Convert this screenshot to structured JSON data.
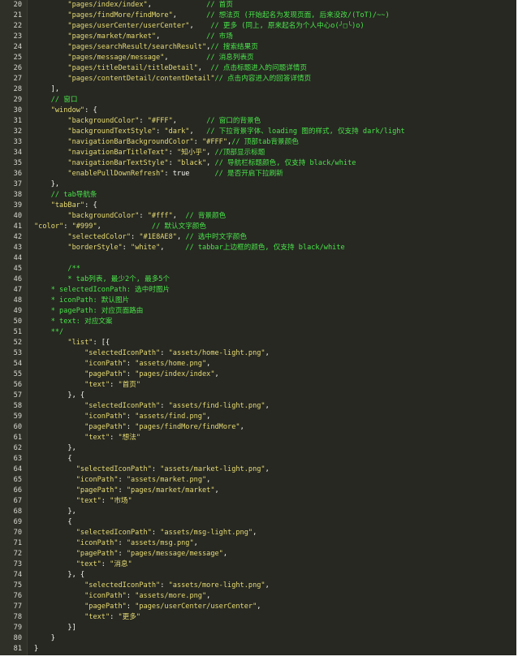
{
  "editor": {
    "lines": [
      {
        "n": "20",
        "indent": "        ",
        "tokens": [
          {
            "t": "\"pages/index/index\"",
            "c": "s"
          },
          {
            "t": ",             ",
            "c": "p"
          },
          {
            "t": "// 首页",
            "c": "c"
          }
        ]
      },
      {
        "n": "21",
        "indent": "        ",
        "tokens": [
          {
            "t": "\"pages/findMore/findMore\"",
            "c": "s"
          },
          {
            "t": ",       ",
            "c": "p"
          },
          {
            "t": "// 想法页 (开始起名为发现页面, 后来没改/(ToT)/~~)",
            "c": "c"
          }
        ]
      },
      {
        "n": "22",
        "indent": "        ",
        "tokens": [
          {
            "t": "\"pages/userCenter/userCenter\"",
            "c": "s"
          },
          {
            "t": ",    ",
            "c": "p"
          },
          {
            "t": "// 更多 (同上, 原来起名为个人中心o(╯□╰)o)",
            "c": "c"
          }
        ]
      },
      {
        "n": "23",
        "indent": "        ",
        "tokens": [
          {
            "t": "\"pages/market/market\"",
            "c": "s"
          },
          {
            "t": ",           ",
            "c": "p"
          },
          {
            "t": "// 市场",
            "c": "c"
          }
        ]
      },
      {
        "n": "24",
        "indent": "        ",
        "tokens": [
          {
            "t": "\"pages/searchResult/searchResult\"",
            "c": "s"
          },
          {
            "t": ",",
            "c": "p"
          },
          {
            "t": "// 搜索结果页",
            "c": "c"
          }
        ]
      },
      {
        "n": "25",
        "indent": "        ",
        "tokens": [
          {
            "t": "\"pages/message/message\"",
            "c": "s"
          },
          {
            "t": ",         ",
            "c": "p"
          },
          {
            "t": "// 消息列表页",
            "c": "c"
          }
        ]
      },
      {
        "n": "26",
        "indent": "        ",
        "tokens": [
          {
            "t": "\"pages/titleDetail/titleDetail\"",
            "c": "s"
          },
          {
            "t": ",  ",
            "c": "p"
          },
          {
            "t": "// 点击标题进入的问题详情页",
            "c": "c"
          }
        ]
      },
      {
        "n": "27",
        "indent": "        ",
        "tokens": [
          {
            "t": "\"pages/contentDetail/contentDetail\"",
            "c": "s"
          },
          {
            "t": "// 点击内容进入的回答详情页",
            "c": "c"
          }
        ]
      },
      {
        "n": "28",
        "indent": "    ",
        "tokens": [
          {
            "t": "],",
            "c": "p"
          }
        ]
      },
      {
        "n": "29",
        "indent": "    ",
        "tokens": [
          {
            "t": "// 窗口",
            "c": "c"
          }
        ]
      },
      {
        "n": "30",
        "indent": "    ",
        "tokens": [
          {
            "t": "\"window\"",
            "c": "s"
          },
          {
            "t": ": {",
            "c": "p"
          }
        ]
      },
      {
        "n": "31",
        "indent": "        ",
        "tokens": [
          {
            "t": "\"backgroundColor\"",
            "c": "s"
          },
          {
            "t": ": ",
            "c": "p"
          },
          {
            "t": "\"#FFF\"",
            "c": "s"
          },
          {
            "t": ",       ",
            "c": "p"
          },
          {
            "t": "// 窗口的背景色",
            "c": "c"
          }
        ]
      },
      {
        "n": "32",
        "indent": "        ",
        "tokens": [
          {
            "t": "\"backgroundTextStyle\"",
            "c": "s"
          },
          {
            "t": ": ",
            "c": "p"
          },
          {
            "t": "\"dark\"",
            "c": "s"
          },
          {
            "t": ",   ",
            "c": "p"
          },
          {
            "t": "// 下拉背景字体、loading 图的样式, 仅支持 dark/light",
            "c": "c"
          }
        ]
      },
      {
        "n": "33",
        "indent": "        ",
        "tokens": [
          {
            "t": "\"navigationBarBackgroundColor\"",
            "c": "s"
          },
          {
            "t": ": ",
            "c": "p"
          },
          {
            "t": "\"#FFF\"",
            "c": "s"
          },
          {
            "t": ",",
            "c": "p"
          },
          {
            "t": "// 顶部tab背景颜色",
            "c": "c"
          }
        ]
      },
      {
        "n": "34",
        "indent": "        ",
        "tokens": [
          {
            "t": "\"navigationBarTitleText\"",
            "c": "s"
          },
          {
            "t": ": ",
            "c": "p"
          },
          {
            "t": "\"知小乎\"",
            "c": "s"
          },
          {
            "t": ", ",
            "c": "p"
          },
          {
            "t": "//顶部显示标题",
            "c": "c"
          }
        ]
      },
      {
        "n": "35",
        "indent": "        ",
        "tokens": [
          {
            "t": "\"navigationBarTextStyle\"",
            "c": "s"
          },
          {
            "t": ": ",
            "c": "p"
          },
          {
            "t": "\"black\"",
            "c": "s"
          },
          {
            "t": ", ",
            "c": "p"
          },
          {
            "t": "// 导航栏标题颜色, 仅支持 black/white",
            "c": "c"
          }
        ]
      },
      {
        "n": "36",
        "indent": "        ",
        "tokens": [
          {
            "t": "\"enablePullDownRefresh\"",
            "c": "s"
          },
          {
            "t": ": true      ",
            "c": "p"
          },
          {
            "t": "// 是否开启下拉刷新",
            "c": "c"
          }
        ]
      },
      {
        "n": "37",
        "indent": "    ",
        "tokens": [
          {
            "t": "},",
            "c": "p"
          }
        ]
      },
      {
        "n": "38",
        "indent": "    ",
        "tokens": [
          {
            "t": "// tab导航条",
            "c": "c"
          }
        ]
      },
      {
        "n": "39",
        "indent": "    ",
        "tokens": [
          {
            "t": "\"tabBar\"",
            "c": "s"
          },
          {
            "t": ": {",
            "c": "p"
          }
        ]
      },
      {
        "n": "40",
        "indent": "        ",
        "tokens": [
          {
            "t": "\"backgroundColor\"",
            "c": "s"
          },
          {
            "t": ": ",
            "c": "p"
          },
          {
            "t": "\"#fff\"",
            "c": "s"
          },
          {
            "t": ",  ",
            "c": "p"
          },
          {
            "t": "// 背景颜色",
            "c": "c"
          }
        ]
      },
      {
        "n": "41",
        "indent": "",
        "tokens": [
          {
            "t": "\"color\"",
            "c": "s"
          },
          {
            "t": ": ",
            "c": "p"
          },
          {
            "t": "\"#999\"",
            "c": "s"
          },
          {
            "t": ",            ",
            "c": "p"
          },
          {
            "t": "// 默认文字颜色",
            "c": "c"
          }
        ]
      },
      {
        "n": "42",
        "indent": "        ",
        "tokens": [
          {
            "t": "\"selectedColor\"",
            "c": "s"
          },
          {
            "t": ": ",
            "c": "p"
          },
          {
            "t": "\"#1E8AE8\"",
            "c": "s"
          },
          {
            "t": ", ",
            "c": "p"
          },
          {
            "t": "// 选中时文字颜色",
            "c": "c"
          }
        ]
      },
      {
        "n": "43",
        "indent": "        ",
        "tokens": [
          {
            "t": "\"borderStyle\"",
            "c": "s"
          },
          {
            "t": ": ",
            "c": "p"
          },
          {
            "t": "\"white\"",
            "c": "s"
          },
          {
            "t": ",     ",
            "c": "p"
          },
          {
            "t": "// tabbar上边框的颜色, 仅支持 black/white",
            "c": "c"
          }
        ]
      },
      {
        "n": "44",
        "indent": "",
        "tokens": []
      },
      {
        "n": "45",
        "indent": "        ",
        "tokens": [
          {
            "t": "/**",
            "c": "c"
          }
        ]
      },
      {
        "n": "46",
        "indent": "        ",
        "tokens": [
          {
            "t": "* tab列表, 最少2个, 最多5个",
            "c": "c"
          }
        ]
      },
      {
        "n": "47",
        "indent": "    ",
        "tokens": [
          {
            "t": "* selectedIconPath: 选中时图片",
            "c": "c"
          }
        ]
      },
      {
        "n": "48",
        "indent": "    ",
        "tokens": [
          {
            "t": "* iconPath: 默认图片",
            "c": "c"
          }
        ]
      },
      {
        "n": "49",
        "indent": "    ",
        "tokens": [
          {
            "t": "* pagePath: 对应页面路由",
            "c": "c"
          }
        ]
      },
      {
        "n": "50",
        "indent": "    ",
        "tokens": [
          {
            "t": "* text: 对应文案",
            "c": "c"
          }
        ]
      },
      {
        "n": "51",
        "indent": "    ",
        "tokens": [
          {
            "t": "**/",
            "c": "c"
          }
        ]
      },
      {
        "n": "52",
        "indent": "        ",
        "tokens": [
          {
            "t": "\"list\"",
            "c": "s"
          },
          {
            "t": ": [{",
            "c": "p"
          }
        ]
      },
      {
        "n": "53",
        "indent": "            ",
        "tokens": [
          {
            "t": "\"selectedIconPath\"",
            "c": "s"
          },
          {
            "t": ": ",
            "c": "p"
          },
          {
            "t": "\"assets/home-light.png\"",
            "c": "s"
          },
          {
            "t": ",",
            "c": "p"
          }
        ]
      },
      {
        "n": "54",
        "indent": "            ",
        "tokens": [
          {
            "t": "\"iconPath\"",
            "c": "s"
          },
          {
            "t": ": ",
            "c": "p"
          },
          {
            "t": "\"assets/home.png\"",
            "c": "s"
          },
          {
            "t": ",",
            "c": "p"
          }
        ]
      },
      {
        "n": "55",
        "indent": "            ",
        "tokens": [
          {
            "t": "\"pagePath\"",
            "c": "s"
          },
          {
            "t": ": ",
            "c": "p"
          },
          {
            "t": "\"pages/index/index\"",
            "c": "s"
          },
          {
            "t": ",",
            "c": "p"
          }
        ]
      },
      {
        "n": "56",
        "indent": "            ",
        "tokens": [
          {
            "t": "\"text\"",
            "c": "s"
          },
          {
            "t": ": ",
            "c": "p"
          },
          {
            "t": "\"首页\"",
            "c": "s"
          }
        ]
      },
      {
        "n": "57",
        "indent": "        ",
        "tokens": [
          {
            "t": "}, {",
            "c": "p"
          }
        ]
      },
      {
        "n": "58",
        "indent": "            ",
        "tokens": [
          {
            "t": "\"selectedIconPath\"",
            "c": "s"
          },
          {
            "t": ": ",
            "c": "p"
          },
          {
            "t": "\"assets/find-light.png\"",
            "c": "s"
          },
          {
            "t": ",",
            "c": "p"
          }
        ]
      },
      {
        "n": "59",
        "indent": "            ",
        "tokens": [
          {
            "t": "\"iconPath\"",
            "c": "s"
          },
          {
            "t": ": ",
            "c": "p"
          },
          {
            "t": "\"assets/find.png\"",
            "c": "s"
          },
          {
            "t": ",",
            "c": "p"
          }
        ]
      },
      {
        "n": "60",
        "indent": "            ",
        "tokens": [
          {
            "t": "\"pagePath\"",
            "c": "s"
          },
          {
            "t": ": ",
            "c": "p"
          },
          {
            "t": "\"pages/findMore/findMore\"",
            "c": "s"
          },
          {
            "t": ",",
            "c": "p"
          }
        ]
      },
      {
        "n": "61",
        "indent": "            ",
        "tokens": [
          {
            "t": "\"text\"",
            "c": "s"
          },
          {
            "t": ": ",
            "c": "p"
          },
          {
            "t": "\"想法\"",
            "c": "s"
          }
        ]
      },
      {
        "n": "62",
        "indent": "        ",
        "tokens": [
          {
            "t": "},",
            "c": "p"
          }
        ]
      },
      {
        "n": "63",
        "indent": "        ",
        "tokens": [
          {
            "t": "{",
            "c": "p"
          }
        ]
      },
      {
        "n": "64",
        "indent": "          ",
        "tokens": [
          {
            "t": "\"selectedIconPath\"",
            "c": "s"
          },
          {
            "t": ": ",
            "c": "p"
          },
          {
            "t": "\"assets/market-light.png\"",
            "c": "s"
          },
          {
            "t": ",",
            "c": "p"
          }
        ]
      },
      {
        "n": "65",
        "indent": "          ",
        "tokens": [
          {
            "t": "\"iconPath\"",
            "c": "s"
          },
          {
            "t": ": ",
            "c": "p"
          },
          {
            "t": "\"assets/market.png\"",
            "c": "s"
          },
          {
            "t": ",",
            "c": "p"
          }
        ]
      },
      {
        "n": "66",
        "indent": "          ",
        "tokens": [
          {
            "t": "\"pagePath\"",
            "c": "s"
          },
          {
            "t": ": ",
            "c": "p"
          },
          {
            "t": "\"pages/market/market\"",
            "c": "s"
          },
          {
            "t": ",",
            "c": "p"
          }
        ]
      },
      {
        "n": "67",
        "indent": "          ",
        "tokens": [
          {
            "t": "\"text\"",
            "c": "s"
          },
          {
            "t": ": ",
            "c": "p"
          },
          {
            "t": "\"市场\"",
            "c": "s"
          }
        ]
      },
      {
        "n": "68",
        "indent": "        ",
        "tokens": [
          {
            "t": "},",
            "c": "p"
          }
        ]
      },
      {
        "n": "69",
        "indent": "        ",
        "tokens": [
          {
            "t": "{",
            "c": "p"
          }
        ]
      },
      {
        "n": "70",
        "indent": "          ",
        "tokens": [
          {
            "t": "\"selectedIconPath\"",
            "c": "s"
          },
          {
            "t": ": ",
            "c": "p"
          },
          {
            "t": "\"assets/msg-light.png\"",
            "c": "s"
          },
          {
            "t": ",",
            "c": "p"
          }
        ]
      },
      {
        "n": "71",
        "indent": "          ",
        "tokens": [
          {
            "t": "\"iconPath\"",
            "c": "s"
          },
          {
            "t": ": ",
            "c": "p"
          },
          {
            "t": "\"assets/msg.png\"",
            "c": "s"
          },
          {
            "t": ",",
            "c": "p"
          }
        ]
      },
      {
        "n": "72",
        "indent": "          ",
        "tokens": [
          {
            "t": "\"pagePath\"",
            "c": "s"
          },
          {
            "t": ": ",
            "c": "p"
          },
          {
            "t": "\"pages/message/message\"",
            "c": "s"
          },
          {
            "t": ",",
            "c": "p"
          }
        ]
      },
      {
        "n": "73",
        "indent": "          ",
        "tokens": [
          {
            "t": "\"text\"",
            "c": "s"
          },
          {
            "t": ": ",
            "c": "p"
          },
          {
            "t": "\"消息\"",
            "c": "s"
          }
        ]
      },
      {
        "n": "74",
        "indent": "        ",
        "tokens": [
          {
            "t": "}, {",
            "c": "p"
          }
        ]
      },
      {
        "n": "75",
        "indent": "            ",
        "tokens": [
          {
            "t": "\"selectedIconPath\"",
            "c": "s"
          },
          {
            "t": ": ",
            "c": "p"
          },
          {
            "t": "\"assets/more-light.png\"",
            "c": "s"
          },
          {
            "t": ",",
            "c": "p"
          }
        ]
      },
      {
        "n": "76",
        "indent": "            ",
        "tokens": [
          {
            "t": "\"iconPath\"",
            "c": "s"
          },
          {
            "t": ": ",
            "c": "p"
          },
          {
            "t": "\"assets/more.png\"",
            "c": "s"
          },
          {
            "t": ",",
            "c": "p"
          }
        ]
      },
      {
        "n": "77",
        "indent": "            ",
        "tokens": [
          {
            "t": "\"pagePath\"",
            "c": "s"
          },
          {
            "t": ": ",
            "c": "p"
          },
          {
            "t": "\"pages/userCenter/userCenter\"",
            "c": "s"
          },
          {
            "t": ",",
            "c": "p"
          }
        ]
      },
      {
        "n": "78",
        "indent": "            ",
        "tokens": [
          {
            "t": "\"text\"",
            "c": "s"
          },
          {
            "t": ": ",
            "c": "p"
          },
          {
            "t": "\"更多\"",
            "c": "s"
          }
        ]
      },
      {
        "n": "79",
        "indent": "        ",
        "tokens": [
          {
            "t": "}]",
            "c": "p"
          }
        ]
      },
      {
        "n": "80",
        "indent": "    ",
        "tokens": [
          {
            "t": "}",
            "c": "p"
          }
        ]
      },
      {
        "n": "81",
        "indent": "",
        "tokens": [
          {
            "t": "}",
            "c": "p"
          }
        ]
      }
    ]
  }
}
